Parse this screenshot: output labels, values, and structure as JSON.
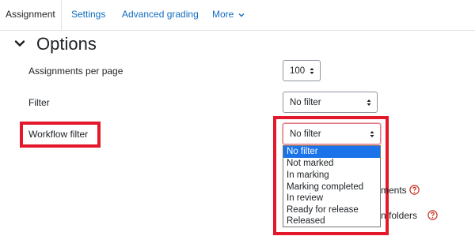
{
  "tabs": [
    {
      "label": "Assignment",
      "active": true
    },
    {
      "label": "Settings"
    },
    {
      "label": "Advanced grading"
    },
    {
      "label": "More"
    }
  ],
  "section": {
    "title": "Options"
  },
  "fields": {
    "per_page": {
      "label": "Assignments per page",
      "value": "100"
    },
    "filter": {
      "label": "Filter",
      "value": "No filter"
    },
    "workflow": {
      "label": "Workflow filter",
      "value": "No filter"
    }
  },
  "workflow_options": [
    "No filter",
    "Not marked",
    "In marking",
    "Marking completed",
    "In review",
    "Ready for release",
    "Released"
  ],
  "partial_text": {
    "row1": "ments",
    "row2": "n folders"
  },
  "colors": {
    "link": "#0f6cbf",
    "highlight": "#e3192b",
    "selected": "#1a73e8",
    "help": "#ca3120"
  },
  "icons": [
    "chevron-down-icon",
    "sort-arrows-icon",
    "question-circle-icon"
  ]
}
